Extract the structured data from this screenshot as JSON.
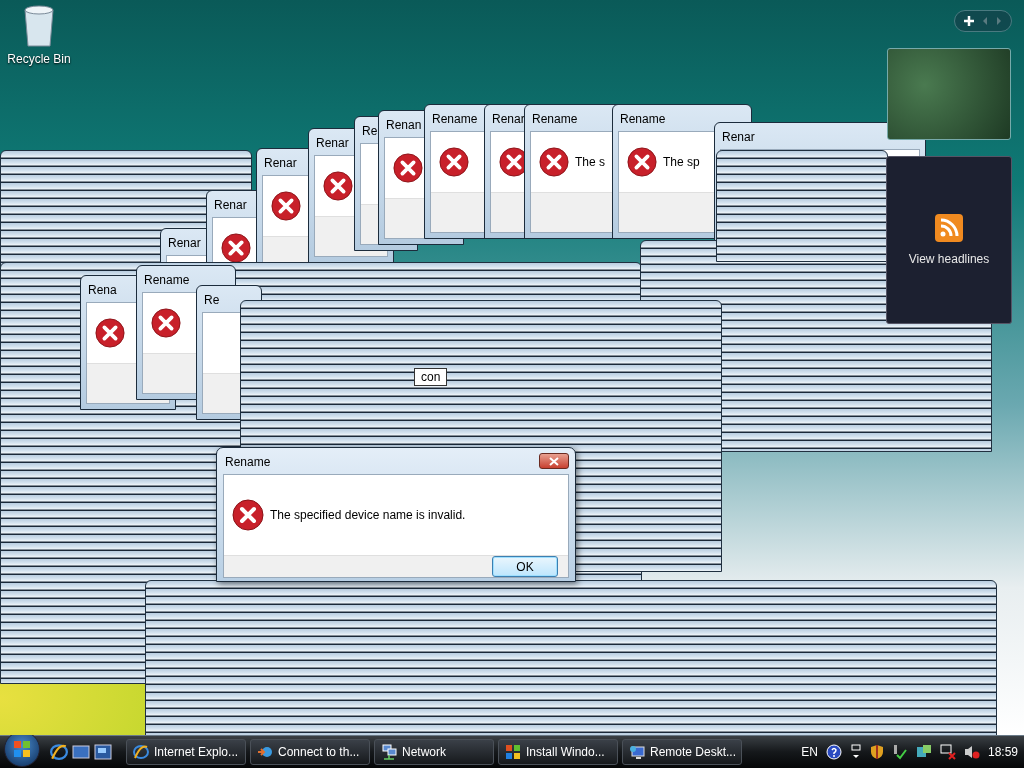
{
  "desktop": {
    "icons": [
      {
        "label": "Recycle Bin"
      }
    ]
  },
  "ghost_windows": [
    {
      "title": "Renar",
      "icon": false
    },
    {
      "title": "Renar",
      "icon": true
    },
    {
      "title": "Renar",
      "icon": true
    },
    {
      "title": "Renar",
      "icon": true
    },
    {
      "title": "Re",
      "icon": false
    },
    {
      "title": "Renan",
      "icon": true
    },
    {
      "title": "Rename",
      "icon": true
    },
    {
      "title": "Renar",
      "icon": true
    },
    {
      "title": "Rename",
      "icon": true,
      "message": "The s"
    },
    {
      "title": "Rename",
      "icon": true,
      "message": "The sp"
    },
    {
      "title": "Renar",
      "icon": false
    },
    {
      "title": "Rena",
      "icon": true
    },
    {
      "title": "Rename",
      "icon": true
    },
    {
      "title": "Re",
      "icon": false
    }
  ],
  "rename_field": {
    "value": "con"
  },
  "dialog": {
    "title": "Rename",
    "message": "The specified device name is invalid.",
    "button": "OK"
  },
  "sidebar": {
    "feed": {
      "label": "View headlines"
    }
  },
  "taskbar": {
    "tasks": [
      {
        "kind": "browser",
        "label": "Internet Explo...",
        "selected": false
      },
      {
        "kind": "connect",
        "label": "Connect to th...",
        "selected": false
      },
      {
        "kind": "network",
        "label": "Network",
        "selected": false
      },
      {
        "kind": "installer",
        "label": "Install Windo...",
        "selected": false
      },
      {
        "kind": "remote",
        "label": "Remote Deskt...",
        "selected": false
      }
    ],
    "language": "EN",
    "clock": "18:59"
  }
}
